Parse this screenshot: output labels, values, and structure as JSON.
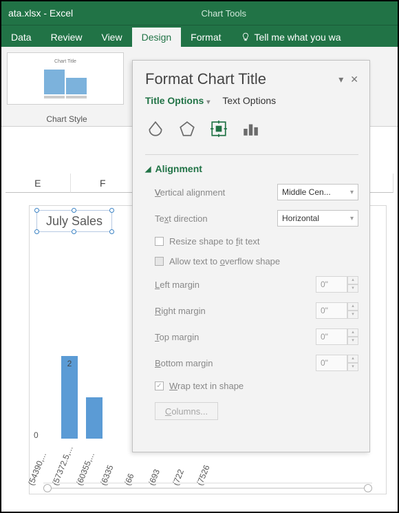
{
  "title": {
    "filename": "ata.xlsx - Excel",
    "context": "Chart Tools"
  },
  "tabs": {
    "data": "Data",
    "review": "Review",
    "view": "View",
    "design": "Design",
    "format": "Format",
    "tellme": "Tell me what you wa"
  },
  "ribbon": {
    "thumb_title": "Chart Title",
    "group_label": "Chart Style"
  },
  "sheet": {
    "columns": [
      "E",
      "F"
    ],
    "chart_title": "July Sales"
  },
  "chart_data": {
    "type": "bar",
    "title": "July Sales",
    "categories": [
      "(54390,...",
      "(57372.5,...",
      "(60355,...",
      "(6335",
      "(66",
      "(693",
      "(722",
      "(7526"
    ],
    "values": [
      null,
      2,
      1,
      null,
      null,
      null,
      null,
      null
    ],
    "bar_label": "2",
    "zero_label": "0"
  },
  "pane": {
    "title": "Format Chart Title",
    "tab_title_options": "Title Options",
    "tab_text_options": "Text Options",
    "section_alignment": "Alignment",
    "vertical_alignment_label": "Vertical alignment",
    "vertical_alignment_value": "Middle Cen...",
    "text_direction_label": "Text direction",
    "text_direction_value": "Horizontal",
    "resize_shape": "Resize shape to fit text",
    "allow_overflow": "Allow text to overflow shape",
    "left_margin": "Left margin",
    "right_margin": "Right margin",
    "top_margin": "Top margin",
    "bottom_margin": "Bottom margin",
    "margin_value": "0\"",
    "wrap_text": "Wrap text in shape",
    "columns_btn": "Columns..."
  }
}
